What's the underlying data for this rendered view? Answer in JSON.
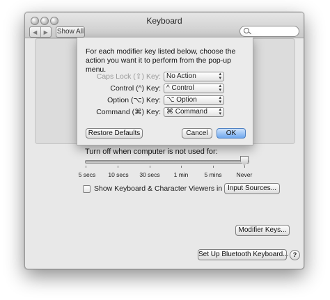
{
  "window": {
    "title": "Keyboard",
    "show_all_label": "Show All",
    "back_glyph": "◀",
    "forward_glyph": "▶"
  },
  "sheet": {
    "description": "For each modifier key listed below, choose the action you want it to perform from the pop-up menu.",
    "rows": [
      {
        "label": "Caps Lock (⇪) Key:",
        "value": "No Action"
      },
      {
        "label": "Control (^) Key:",
        "value": "^ Control"
      },
      {
        "label": "Option (⌥) Key:",
        "value": "⌥ Option"
      },
      {
        "label": "Command (⌘) Key:",
        "value": "⌘ Command"
      }
    ],
    "restore_label": "Restore Defaults",
    "cancel_label": "Cancel",
    "ok_label": "OK"
  },
  "prefs": {
    "turnoff_label": "Turn off when computer is not used for:",
    "slider_ticks": [
      "5 secs",
      "10 secs",
      "30 secs",
      "1 min",
      "5 mins",
      "Never"
    ],
    "slider_value": "Never",
    "viewer_checkbox_label": "Show Keyboard & Character Viewers in menu bar",
    "viewer_checkbox_checked": false,
    "input_sources_label": "Input Sources...",
    "modifier_keys_label": "Modifier Keys...",
    "bluetooth_label": "Set Up Bluetooth Keyboard...",
    "help_glyph": "?"
  }
}
